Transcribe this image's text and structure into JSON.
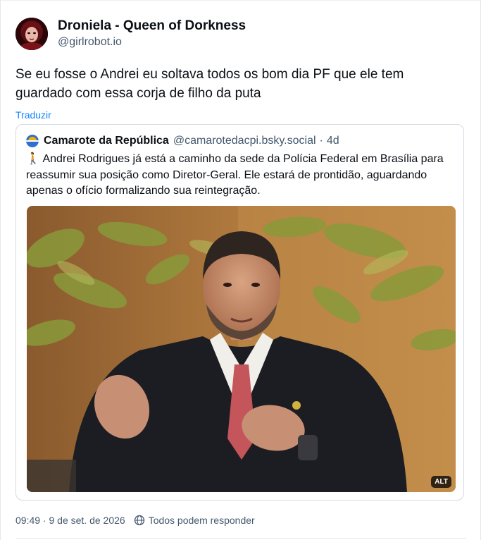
{
  "post": {
    "author": {
      "display_name": "Droniela - Queen of Dorkness",
      "handle": "@girlrobot.io"
    },
    "text": "Se eu fosse o Andrei eu soltava todos os bom dia PF que ele tem guardado com essa corja de filho da puta",
    "translate_label": "Traduzir",
    "quote": {
      "author_name": "Camarote da República",
      "author_handle": "@camarotedacpi.bsky.social",
      "separator": "·",
      "age": "4d",
      "text": "🚶 Andrei Rodrigues já está a caminho da sede da Polícia Federal em Brasília para reassumir sua posição como Diretor-Geral. Ele estará de prontidão, aguardando apenas o ofício formalizando sua reintegração.",
      "image_alt_badge": "ALT"
    },
    "timestamp": "09:49 · 9 de set. de 2026",
    "reply_setting": "Todos podem responder"
  }
}
